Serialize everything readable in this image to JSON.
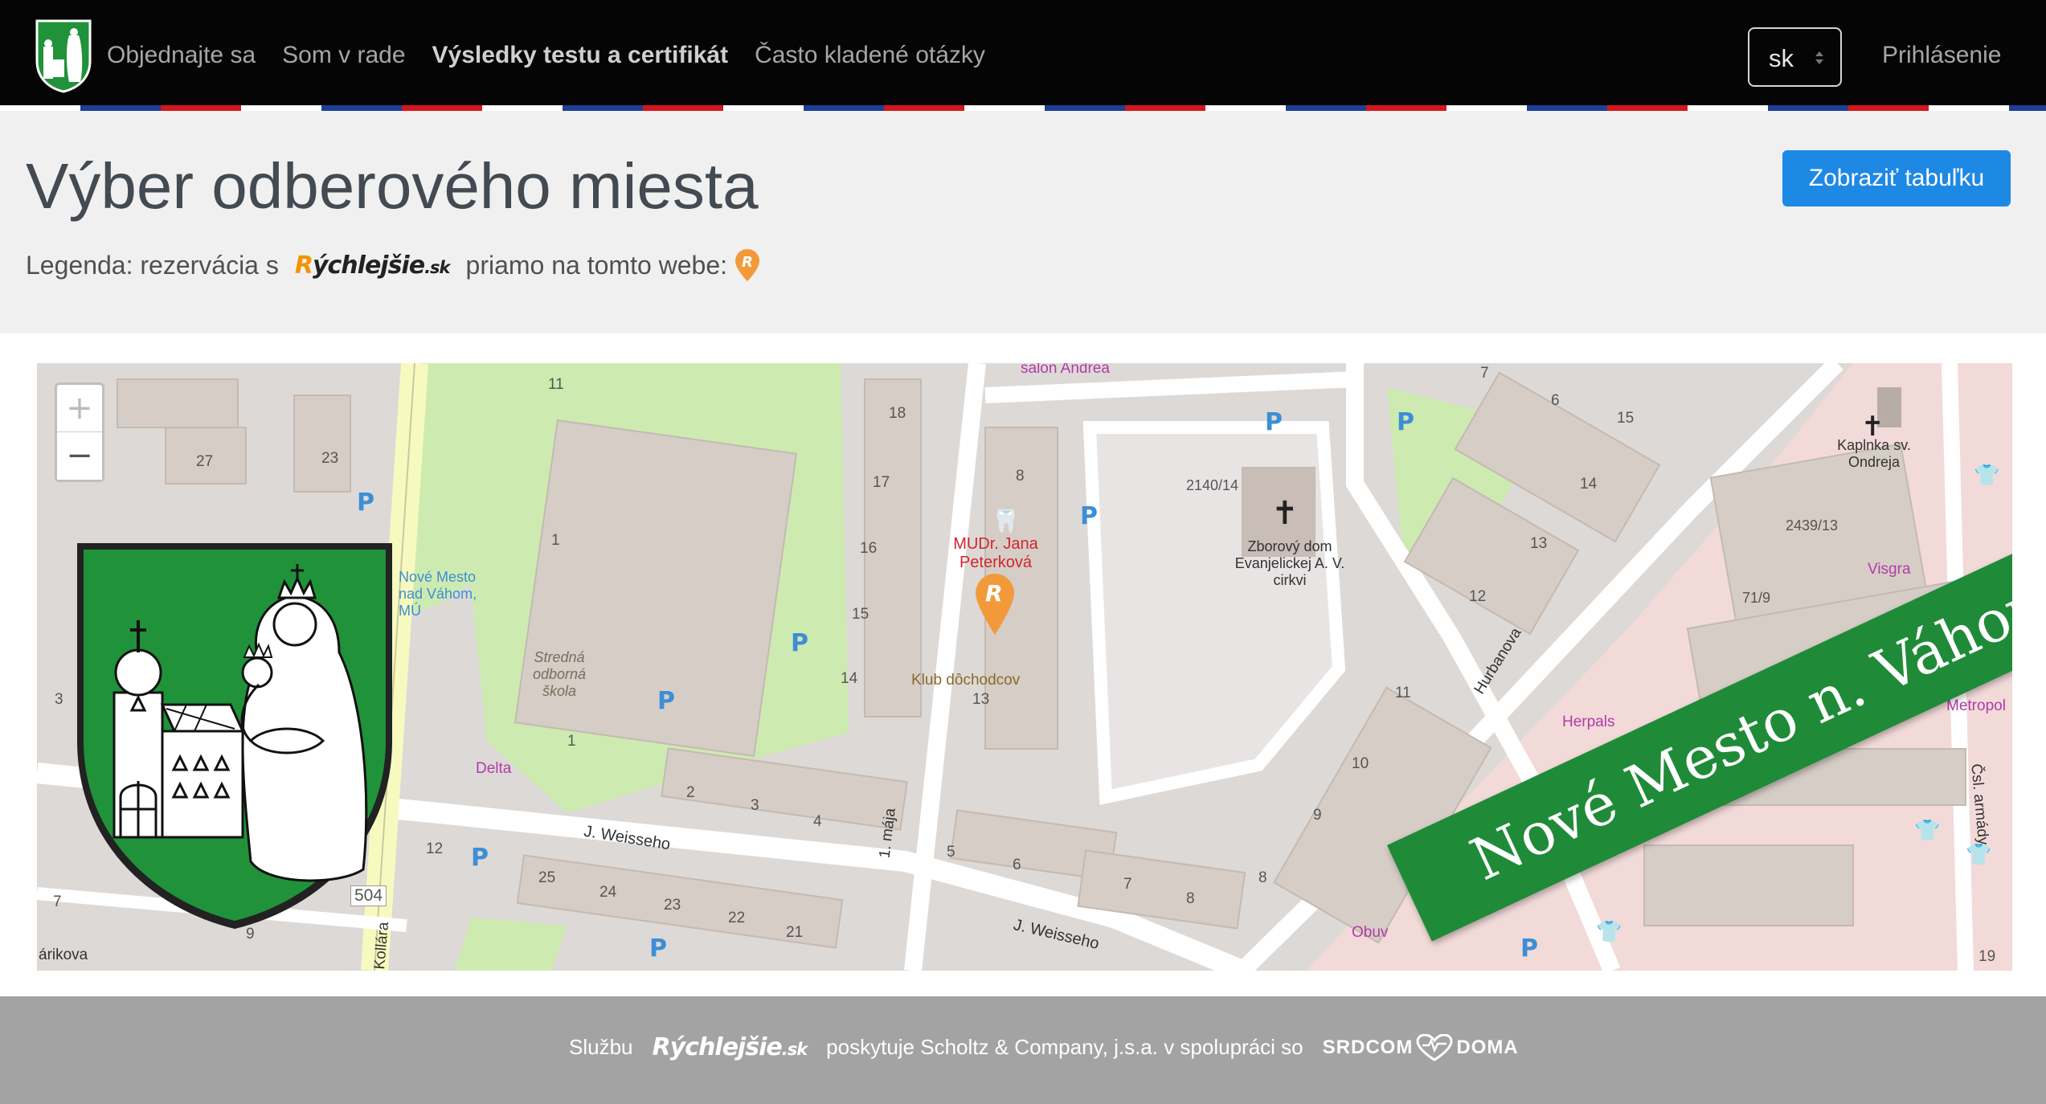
{
  "nav": {
    "links": [
      "Objednajte sa",
      "Som v rade",
      "Výsledky testu a certifikát",
      "Často kladené otázky"
    ],
    "language": "sk",
    "login": "Prihlásenie"
  },
  "header": {
    "title": "Výber odberového miesta",
    "legend_prefix": "Legenda: rezervácia s",
    "legend_suffix": "priamo na tomto webe:",
    "show_table_button": "Zobraziť tabuľku"
  },
  "brand": {
    "logo_first": "R",
    "logo_rest": "ýchlejšie",
    "logo_tld": ".sk"
  },
  "map": {
    "zoom_in": "+",
    "zoom_out": "−",
    "banner": "Nové Mesto n. Váhom",
    "labels": {
      "salon": "salon Andrea",
      "doctor": "MUDr. Jana Peterková",
      "club": "Klub dôchodcov",
      "church": "Zborový dom Evanjelickej A. V. cirkvi",
      "chapel": "Kaplnka sv. Ondreja",
      "school": "Stredná odborná škola",
      "stop": "Nové Mesto nad Váhom, MÚ",
      "delta": "Delta",
      "street_weisseho": "J. Weisseho",
      "street_weisseho2": "J. Weisseho",
      "street_hurbanova": "Hurbanova",
      "street_maja": "1. mája",
      "street_kollara": "Kollára",
      "street_armady": "Čsl. armády",
      "street_arikova": "árikova",
      "herpals": "Herpals",
      "visgra": "Visgra",
      "metropol": "Metropol",
      "obuv": "Obuv",
      "road_504": "504",
      "n2140": "2140/14",
      "n2439": "2439/13",
      "n71": "71/9"
    },
    "house_numbers": [
      "11",
      "27",
      "23",
      "1",
      "1",
      "18",
      "17",
      "16",
      "15",
      "14",
      "8",
      "13",
      "2",
      "3",
      "4",
      "12",
      "25",
      "24",
      "23",
      "22",
      "21",
      "5",
      "6",
      "7",
      "8",
      "8",
      "9",
      "10",
      "11",
      "12",
      "13",
      "14",
      "15",
      "6",
      "7",
      "3",
      "7",
      "9",
      "19"
    ]
  },
  "footer": {
    "prefix": "Službu",
    "text": "poskytuje Scholtz & Company, j.s.a. v spolupráci so",
    "partner_a": "SRDCOM",
    "partner_b": "DOMA"
  },
  "colors": {
    "navbar": "#050505",
    "button": "#1e88e5",
    "banner": "#1f8b38",
    "accent_orange": "#f29300",
    "footer": "#a3a3a3"
  }
}
